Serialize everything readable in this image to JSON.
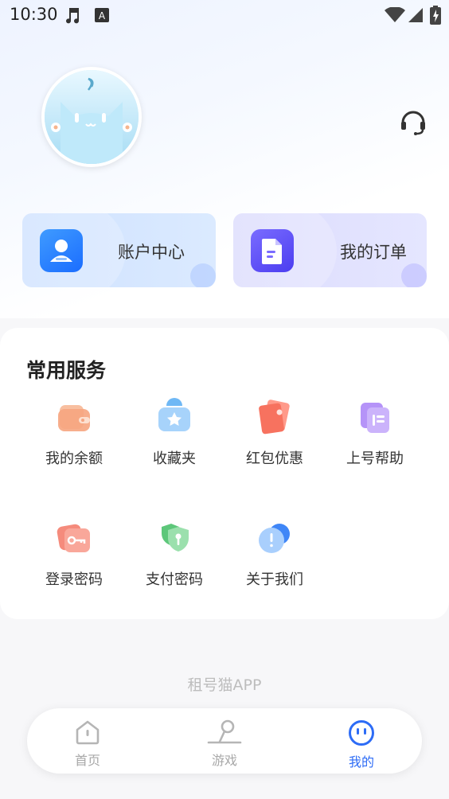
{
  "status_bar": {
    "time": "10:30",
    "icons": [
      "music-note-icon",
      "keyboard-a-icon",
      "wifi-icon",
      "signal-icon",
      "battery-charging-icon"
    ]
  },
  "profile": {
    "avatar_icon": "cat-avatar-icon",
    "support_icon": "headset-icon"
  },
  "quick_cards": [
    {
      "label": "账户中心",
      "icon": "user-icon",
      "color": "#2b7cff"
    },
    {
      "label": "我的订单",
      "icon": "document-icon",
      "color": "#5b4bf5"
    }
  ],
  "services": {
    "title": "常用服务",
    "items": [
      {
        "label": "我的余额",
        "icon": "wallet-icon"
      },
      {
        "label": "收藏夹",
        "icon": "star-folder-icon"
      },
      {
        "label": "红包优惠",
        "icon": "red-packet-icon"
      },
      {
        "label": "上号帮助",
        "icon": "help-document-icon"
      },
      {
        "label": "登录密码",
        "icon": "key-icon"
      },
      {
        "label": "支付密码",
        "icon": "shield-key-icon"
      },
      {
        "label": "关于我们",
        "icon": "info-icon"
      }
    ]
  },
  "footer": {
    "brand": "租号猫APP"
  },
  "tabbar": {
    "tabs": [
      {
        "label": "首页",
        "icon": "home-icon",
        "active": false
      },
      {
        "label": "游戏",
        "icon": "game-icon",
        "active": false
      },
      {
        "label": "我的",
        "icon": "smile-face-icon",
        "active": true
      }
    ],
    "active_color": "#2d6cf6",
    "inactive_color": "#a8a8a8"
  }
}
